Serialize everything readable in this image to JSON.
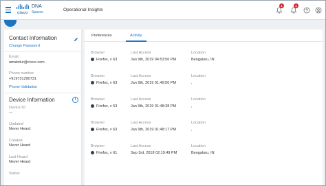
{
  "header": {
    "brand_cisco": "cisco",
    "brand_dna": "DNA",
    "brand_spaces": "Spaces",
    "app_title": "Operational Insights",
    "badges": [
      "1",
      "1"
    ]
  },
  "contact": {
    "title": "Contact Information",
    "change_password": "Change Password",
    "email_label": "Email",
    "email_value": "amabdur@cisco.com",
    "phone_label": "Phone number",
    "phone_value": "+919731290731",
    "phone_validation": "Phone Validation"
  },
  "device": {
    "title": "Device Information",
    "device_id_label": "Device ID",
    "device_id_value": "---",
    "updated_label": "Updated",
    "updated_value": "Never Heard",
    "created_label": "Created",
    "created_value": "Never Heard",
    "last_heard_label": "Last Heard",
    "last_heard_value": "Never Heard",
    "status_label": "Status"
  },
  "tabs": [
    {
      "label": "Preferences"
    },
    {
      "label": "Activity"
    }
  ],
  "activity_headers": {
    "browser": "Browser",
    "last_access": "Last Access",
    "location": "Location"
  },
  "activity": [
    {
      "browser": "Firefox, v 63",
      "last_access": "Jan 9th, 2019 04:53:56 PM",
      "location": "Bengaluru, IN"
    },
    {
      "browser": "Firefox, v 63",
      "last_access": "Jan 9th, 2019 01:49:50 PM",
      "location": ","
    },
    {
      "browser": "Firefox, v 63",
      "last_access": "Jan 9th, 2019 01:48:38 PM",
      "location": ","
    },
    {
      "browser": "Firefox, v 63",
      "last_access": "Jan 9th, 2019 01:48:17 PM",
      "location": ","
    },
    {
      "browser": "Firefox, v 61",
      "last_access": "Sep 3rd, 2018 02:19:49 PM",
      "location": "Bengaluru, IN"
    }
  ],
  "colors": {
    "accent": "#1f77c8",
    "badge": "#d9262c"
  }
}
